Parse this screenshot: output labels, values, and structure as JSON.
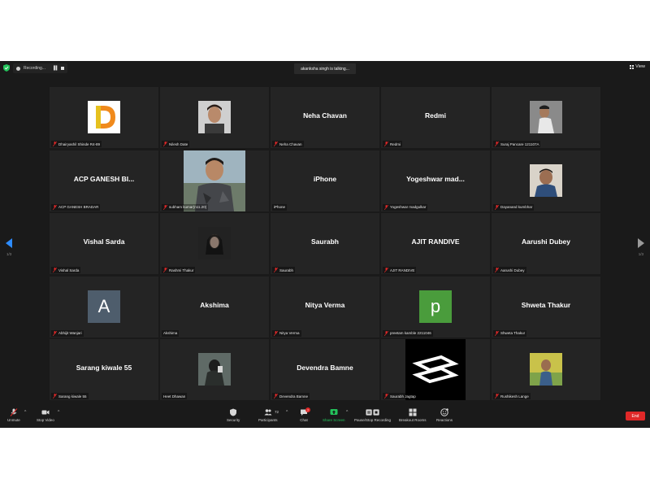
{
  "topbar": {
    "recording_text": "Recording...",
    "talking_text": "akanksha singh is talking...",
    "view_label": "View"
  },
  "navigation": {
    "page_left": "1/3",
    "page_right": "1/3"
  },
  "tiles": [
    {
      "display": "",
      "label": "Dhairyashil Shinde R4-89"
    },
    {
      "display": "",
      "label": "Nilesh Date"
    },
    {
      "display": "Neha Chavan",
      "label": "Neha Chavan"
    },
    {
      "display": "Redmi",
      "label": "Redmi"
    },
    {
      "display": "",
      "label": "Suraj Pancare 121107A"
    },
    {
      "display": "ACP GANESH BI...",
      "label": "ACP GANESH BRADAR"
    },
    {
      "display": "",
      "label": "subham kumar(n11.20)"
    },
    {
      "display": "iPhone",
      "label": "iPhone"
    },
    {
      "display": "Yogeshwar mad...",
      "label": "Yogeshwar madgulkar"
    },
    {
      "display": "",
      "label": "Dayanand kumbhar"
    },
    {
      "display": "Vishal Sarda",
      "label": "Vishal Sarda"
    },
    {
      "display": "",
      "label": "Rashmi Thakur"
    },
    {
      "display": "Saurabh",
      "label": "Saurabh"
    },
    {
      "display": "AJIT RANDIVE",
      "label": "AJIT RANDIVE"
    },
    {
      "display": "Aarushi Dubey",
      "label": "Aarushi Dubey"
    },
    {
      "display": "",
      "label": "Abhijit Wanjari",
      "avatar_letter": "A",
      "avatar_color": "#4e5d6c"
    },
    {
      "display": "Akshima",
      "label": "Akshima"
    },
    {
      "display": "Nitya Verma",
      "label": "Nitya Verma"
    },
    {
      "display": "",
      "label": "preetam kamble 2211046",
      "avatar_letter": "p",
      "avatar_color": "#4a9c3c"
    },
    {
      "display": "Shweta Thakur",
      "label": "Shweta Thakur"
    },
    {
      "display": "Sarang kiwale 55",
      "label": "Sarang kiwale 55"
    },
    {
      "display": "",
      "label": "Heet Dhawan"
    },
    {
      "display": "Devendra Bamne",
      "label": "Devendra Bamne"
    },
    {
      "display": "",
      "label": "Saurabh Jagtap"
    },
    {
      "display": "",
      "label": "Rushikesh Lange"
    }
  ],
  "toolbar": {
    "unmute": "Unmute",
    "stop_video": "Stop Video",
    "security": "Security",
    "participants": "Participants",
    "participants_count": "72",
    "chat": "Chat",
    "chat_badge": "7",
    "share_screen": "Share Screen",
    "pause_recording": "Pause/Stop Recording",
    "breakout_rooms": "Breakout Rooms",
    "reactions": "Reactions",
    "end": "End"
  },
  "colors": {
    "accent_blue": "#2d8cff",
    "end_red": "#e02828",
    "share_green": "#23c35b",
    "tile_bg": "#242424"
  }
}
